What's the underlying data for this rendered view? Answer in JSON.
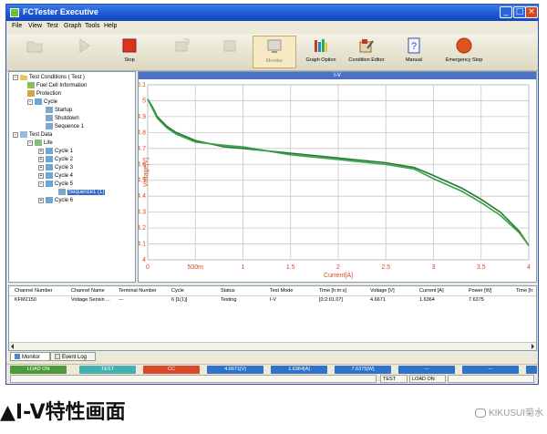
{
  "window": {
    "title": "FCTester Executive"
  },
  "menu": [
    "File",
    "View",
    "Test",
    "Graph",
    "Tools",
    "Help"
  ],
  "toolbar": {
    "buttons": [
      {
        "label": "",
        "icon": "open-folder-icon",
        "enabled": false
      },
      {
        "label": "",
        "icon": "play-icon",
        "enabled": false
      },
      {
        "label": "Stop",
        "icon": "stop-icon",
        "enabled": true
      },
      {
        "label": "",
        "icon": "resume-icon",
        "enabled": false
      },
      {
        "label": "",
        "icon": "export-icon",
        "enabled": false
      },
      {
        "label": "Monitor",
        "icon": "monitor-icon",
        "enabled": false
      },
      {
        "label": "Graph Option",
        "icon": "graph-option-icon",
        "enabled": true
      },
      {
        "label": "Condition Editor",
        "icon": "condition-editor-icon",
        "enabled": true
      },
      {
        "label": "Manual",
        "icon": "help-icon",
        "enabled": true
      },
      {
        "label": "Emergency Stop",
        "icon": "emergency-stop-icon",
        "enabled": true
      }
    ]
  },
  "tree": [
    {
      "label": "Test Conditions ( Test )",
      "level": 0,
      "expander": "−"
    },
    {
      "label": "Fuel Cell Information",
      "level": 1,
      "expander": ""
    },
    {
      "label": "Protection",
      "level": 1,
      "expander": ""
    },
    {
      "label": "Cycle",
      "level": 1,
      "expander": "−"
    },
    {
      "label": "Startup",
      "level": 2,
      "expander": ""
    },
    {
      "label": "Shutdown",
      "level": 2,
      "expander": ""
    },
    {
      "label": "Sequence 1",
      "level": 2,
      "expander": ""
    },
    {
      "label": "Test Data",
      "level": 0,
      "expander": "−"
    },
    {
      "label": "Life",
      "level": 1,
      "expander": "−"
    },
    {
      "label": "Cycle 1",
      "level": 2,
      "expander": "+"
    },
    {
      "label": "Cycle 2",
      "level": 2,
      "expander": "+"
    },
    {
      "label": "Cycle 3",
      "level": 2,
      "expander": "+"
    },
    {
      "label": "Cycle 4",
      "level": 2,
      "expander": "+"
    },
    {
      "label": "Cycle 5",
      "level": 2,
      "expander": "−"
    },
    {
      "label": "Sequence1 (1)",
      "level": 3,
      "expander": "",
      "selected": true
    },
    {
      "label": "Cycle 6",
      "level": 2,
      "expander": "+"
    }
  ],
  "graph": {
    "header": "I-V"
  },
  "chart_data": {
    "type": "line",
    "title": "I-V",
    "xlabel": "Current[A]",
    "ylabel": "Voltage[V]",
    "xlim": [
      0,
      4
    ],
    "ylim": [
      4.0,
      5.1
    ],
    "xticks": [
      "0",
      "500m",
      "1",
      "1.5",
      "2",
      "2.5",
      "3",
      "3.5",
      "4"
    ],
    "yticks": [
      "4",
      "4.1",
      "4.2",
      "4.3",
      "4.4",
      "4.5",
      "4.6",
      "4.7",
      "4.8",
      "4.9",
      "5",
      "5.1"
    ],
    "grid": true,
    "series": [
      {
        "x": [
          0,
          0.05,
          0.1,
          0.2,
          0.3,
          0.5,
          0.8,
          1.0,
          1.5,
          2.0,
          2.5,
          2.8,
          3.0,
          3.3,
          3.5,
          3.7,
          3.9,
          4.0
        ],
        "y": [
          5.01,
          4.96,
          4.9,
          4.84,
          4.8,
          4.75,
          4.71,
          4.7,
          4.67,
          4.64,
          4.61,
          4.58,
          4.53,
          4.45,
          4.38,
          4.3,
          4.18,
          4.09
        ]
      },
      {
        "x": [
          0,
          0.05,
          0.1,
          0.2,
          0.3,
          0.5,
          0.8,
          1.0,
          1.5,
          2.0,
          2.5,
          2.8,
          3.0,
          3.3,
          3.5,
          3.7,
          3.9,
          4.0
        ],
        "y": [
          5.01,
          4.95,
          4.89,
          4.83,
          4.79,
          4.74,
          4.72,
          4.71,
          4.66,
          4.63,
          4.6,
          4.57,
          4.51,
          4.43,
          4.36,
          4.28,
          4.17,
          4.09
        ]
      }
    ]
  },
  "table": {
    "columns": [
      "Channel Number",
      "Channel Name",
      "Terminal Number",
      "Cycle",
      "Status",
      "Test Mode",
      "Time [h:m:s]",
      "Voltage [V]",
      "Current [A]",
      "Power [W]",
      "Time [h:"
    ],
    "rows": [
      [
        "KFM2150",
        "Voltage Sensin ...",
        "---",
        "6 [1(1)]",
        "Testing",
        "I-V",
        "[0:2:01.07]",
        "4.6671",
        "1.6364",
        "7.6375",
        ""
      ]
    ]
  },
  "tabs": [
    "Monitor",
    "Event Log"
  ],
  "status": [
    {
      "label": "LOAD ON",
      "color": "#4c9a3c"
    },
    {
      "label": "TEST",
      "color": "#45b0b0"
    },
    {
      "label": "CC",
      "color": "#d64a2a"
    },
    {
      "label": "4.6671[V]",
      "color": "#2f73c8"
    },
    {
      "label": "1.6364[A]",
      "color": "#2f73c8"
    },
    {
      "label": "7.6375[W]",
      "color": "#2f73c8"
    },
    {
      "label": "---",
      "color": "#2f73c8"
    },
    {
      "label": "---",
      "color": "#2f73c8"
    },
    {
      "label": "",
      "color": "#2f73c8"
    }
  ],
  "footer": [
    "TEST",
    "LOAD ON"
  ],
  "caption": "▲I-V特性画面",
  "watermark": "KIKUSUI菊水"
}
